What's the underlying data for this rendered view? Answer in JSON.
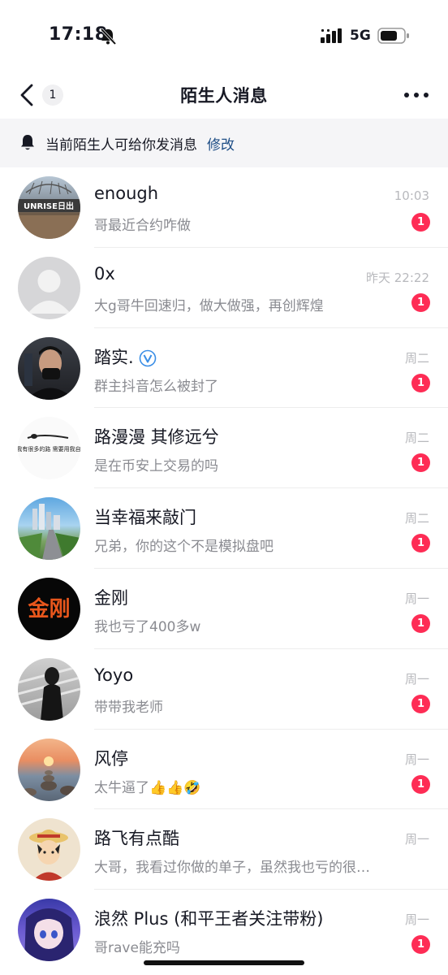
{
  "status_bar": {
    "time": "17:18",
    "network": "5G"
  },
  "nav": {
    "badge": "1",
    "title": "陌生人消息"
  },
  "notice": {
    "text": "当前陌生人可给你发消息",
    "link": "修改"
  },
  "messages": [
    {
      "name": "enough",
      "time": "10:03",
      "preview": "哥最近合约咋做",
      "unread": "1",
      "avatar_text": "UNRISE日出"
    },
    {
      "name": "0x",
      "time": "昨天 22:22",
      "preview": "大g哥牛回速归，做大做强，再创辉煌",
      "unread": "1"
    },
    {
      "name": "踏实.",
      "time": "周二",
      "preview": "群主抖音怎么被封了",
      "unread": "1",
      "verified": true
    },
    {
      "name": "路漫漫 其修远兮",
      "time": "周二",
      "preview": "是在币安上交易的吗",
      "unread": "1",
      "avatar_text": "还生说我有很多的路 需要用我自己的话"
    },
    {
      "name": "当幸福来敲门",
      "time": "周二",
      "preview": "兄弟，你的这个不是模拟盘吧",
      "unread": "1"
    },
    {
      "name": "金刚",
      "time": "周一",
      "preview": "我也亏了400多w",
      "unread": "1",
      "avatar_text": "金刚"
    },
    {
      "name": "Yoyo",
      "time": "周一",
      "preview": "带带我老师",
      "unread": "1"
    },
    {
      "name": "风停",
      "time": "周一",
      "preview": "太牛逼了👍👍🤣",
      "unread": "1"
    },
    {
      "name": "路飞有点酷",
      "time": "周一",
      "preview": "大哥，我看过你做的单子，虽然我也亏的很…",
      "unread": ""
    },
    {
      "name": "浪然 Plus (和平王者关注带粉)",
      "time": "周一",
      "preview": "哥rave能充吗",
      "unread": "1"
    }
  ],
  "colors": {
    "accent_red": "#fe2c55",
    "link_blue": "#1e4e86",
    "secondary_text": "#8a8b91",
    "time_text": "#b8b9bd"
  }
}
